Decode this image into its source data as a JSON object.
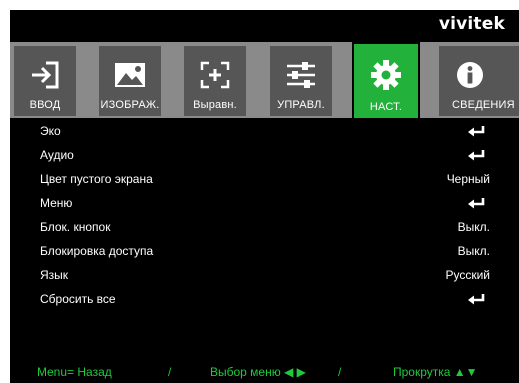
{
  "brand": "vivitek",
  "tabs": [
    {
      "label": "ВВОД",
      "icon": "input-icon",
      "active": false
    },
    {
      "label": "ИЗОБРАЖ.",
      "icon": "image-icon",
      "active": false
    },
    {
      "label": "Выравн.",
      "icon": "alignment-icon",
      "active": false
    },
    {
      "label": "УПРАВЛ.",
      "icon": "sliders-icon",
      "active": false
    },
    {
      "label": "НАСТ.",
      "icon": "gear-icon",
      "active": true
    },
    {
      "label": "СВЕДЕНИЯ",
      "icon": "info-icon",
      "active": false
    }
  ],
  "menu": [
    {
      "name": "Эко",
      "value": "",
      "enter": true
    },
    {
      "name": "Аудио",
      "value": "",
      "enter": true
    },
    {
      "name": "Цвет пустого экрана",
      "value": "Черный",
      "enter": false
    },
    {
      "name": "Меню",
      "value": "",
      "enter": true
    },
    {
      "name": "Блок. кнопок",
      "value": "Выкл.",
      "enter": false
    },
    {
      "name": "Блокировка доступа",
      "value": "Выкл.",
      "enter": false
    },
    {
      "name": "Язык",
      "value": "Русский",
      "enter": false
    },
    {
      "name": "Сбросить все",
      "value": "",
      "enter": true
    }
  ],
  "footer": {
    "back": "Menu= Назад",
    "sep1": "/",
    "select": "Выбор меню ◀ ▶",
    "sep2": "/",
    "scroll": "Прокрутка ▲▼"
  },
  "colors": {
    "accent": "#22b13a",
    "footer_text": "#1ecb3a",
    "tab_bg": "#565656",
    "tab_strip": "#8a8a8a"
  }
}
